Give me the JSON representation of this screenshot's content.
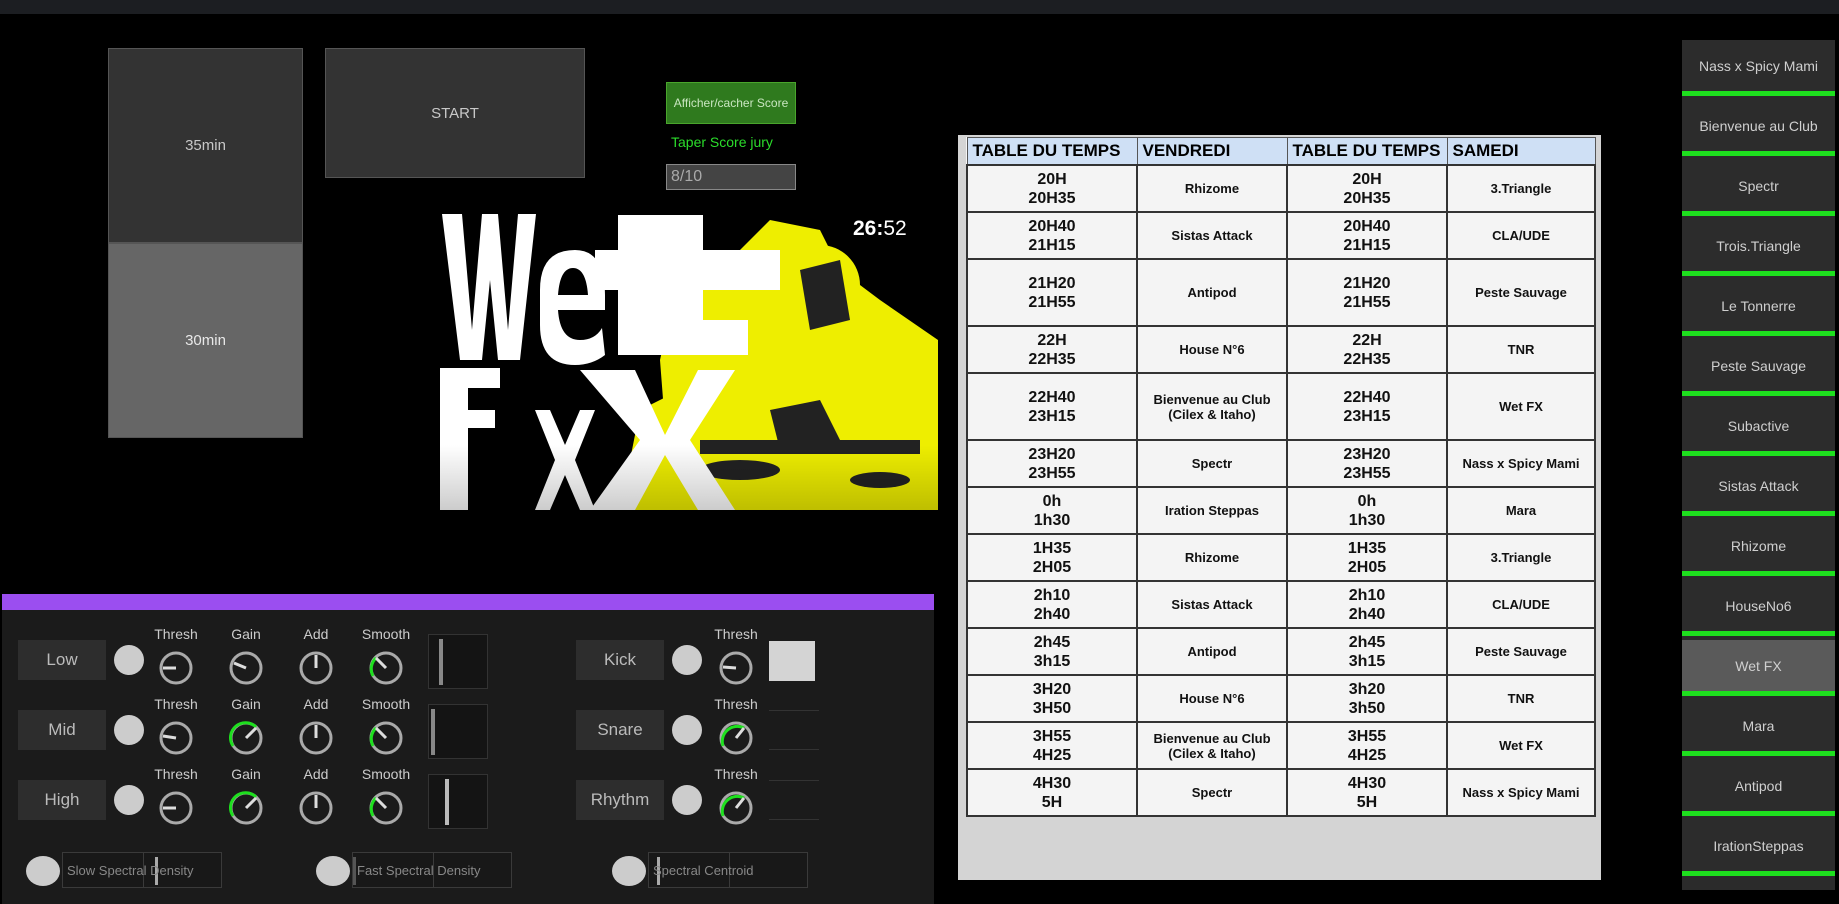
{
  "duration_buttons": [
    "35min",
    "30min"
  ],
  "start_label": "START",
  "score_toggle_label": "Afficher/cacher Score",
  "jury_label": "Taper Score jury",
  "score_value": "8/10",
  "video": {
    "logo_line1": "WeT",
    "logo_line2": "FX",
    "time_min": "26",
    "time_sep": ":",
    "time_sec": "52"
  },
  "accent_colors": {
    "purple_bar": "#9b4ef0",
    "active_green": "#1ee01e",
    "logo_yellow": "#f0f000"
  },
  "bands": [
    {
      "name": "Low",
      "thresh": "Thresh",
      "gain": "Gain",
      "add": "Add",
      "smooth": "Smooth"
    },
    {
      "name": "Mid",
      "thresh": "Thresh",
      "gain": "Gain",
      "add": "Add",
      "smooth": "Smooth"
    },
    {
      "name": "High",
      "thresh": "Thresh",
      "gain": "Gain",
      "add": "Add",
      "smooth": "Smooth"
    }
  ],
  "detectors": [
    {
      "name": "Kick",
      "thresh": "Thresh"
    },
    {
      "name": "Snare",
      "thresh": "Thresh"
    },
    {
      "name": "Rhythm",
      "thresh": "Thresh"
    }
  ],
  "features": [
    "Slow Spectral Density",
    "Fast Spectral Density",
    "Spectral Centroid"
  ],
  "schedule": {
    "headers": [
      "TABLE DU TEMPS",
      "VENDREDI",
      "TABLE DU TEMPS",
      "SAMEDI"
    ],
    "rows": [
      {
        "t1a": "20H",
        "t1b": "20H35",
        "fri": "Rhizome",
        "fri2": "",
        "t2a": "20H",
        "t2b": "20H35",
        "sat": "3.Triangle"
      },
      {
        "t1a": "20H40",
        "t1b": "21H15",
        "fri": "Sistas Attack",
        "fri2": "",
        "t2a": "20H40",
        "t2b": "21H15",
        "sat": "CLA/UDE"
      },
      {
        "t1a": "21H20",
        "t1b": "21H55",
        "fri": "Antipod",
        "fri2": "",
        "t2a": "21H20",
        "t2b": "21H55",
        "sat": "Peste Sauvage"
      },
      {
        "t1a": "22H",
        "t1b": "22H35",
        "fri": "House N°6",
        "fri2": "",
        "t2a": "22H",
        "t2b": "22H35",
        "sat": "TNR"
      },
      {
        "t1a": "22H40",
        "t1b": "23H15",
        "fri": "Bienvenue au Club",
        "fri2": "(Cilex & Itaho)",
        "t2a": "22H40",
        "t2b": "23H15",
        "sat": "Wet FX"
      },
      {
        "t1a": "23H20",
        "t1b": "23H55",
        "fri": "Spectr",
        "fri2": "",
        "t2a": "23H20",
        "t2b": "23H55",
        "sat": "Nass x Spicy Mami"
      },
      {
        "t1a": "0h",
        "t1b": "1h30",
        "fri": "Iration Steppas",
        "fri2": "",
        "t2a": "0h",
        "t2b": "1h30",
        "sat": "Mara"
      },
      {
        "t1a": "1H35",
        "t1b": "2H05",
        "fri": "Rhizome",
        "fri2": "",
        "t2a": "1H35",
        "t2b": "2H05",
        "sat": "3.Triangle"
      },
      {
        "t1a": "2h10",
        "t1b": "2h40",
        "fri": "Sistas Attack",
        "fri2": "",
        "t2a": "2h10",
        "t2b": "2h40",
        "sat": "CLA/UDE"
      },
      {
        "t1a": "2h45",
        "t1b": "3h15",
        "fri": "Antipod",
        "fri2": "",
        "t2a": "2h45",
        "t2b": "3h15",
        "sat": "Peste Sauvage"
      },
      {
        "t1a": "3H20",
        "t1b": "3H50",
        "fri": "House N°6",
        "fri2": "",
        "t2a": "3h20",
        "t2b": "3h50",
        "sat": "TNR"
      },
      {
        "t1a": "3H55",
        "t1b": "4H25",
        "fri": "Bienvenue au Club",
        "fri2": "(Cilex & Itaho)",
        "t2a": "3H55",
        "t2b": "4H25",
        "sat": "Wet FX"
      },
      {
        "t1a": "4H30",
        "t1b": "5H",
        "fri": "Spectr",
        "fri2": "",
        "t2a": "4H30",
        "t2b": "5H",
        "sat": "Nass x Spicy Mami"
      }
    ]
  },
  "playlist": {
    "selected": "Wet FX",
    "items": [
      "Nass x Spicy Mami",
      "Bienvenue au Club",
      "Spectr",
      "Trois.Triangle",
      "Le Tonnerre",
      "Peste Sauvage",
      "Subactive",
      "Sistas Attack",
      "Rhizome",
      "HouseNo6",
      "Wet FX",
      "Mara",
      "Antipod",
      "IrationSteppas"
    ]
  }
}
